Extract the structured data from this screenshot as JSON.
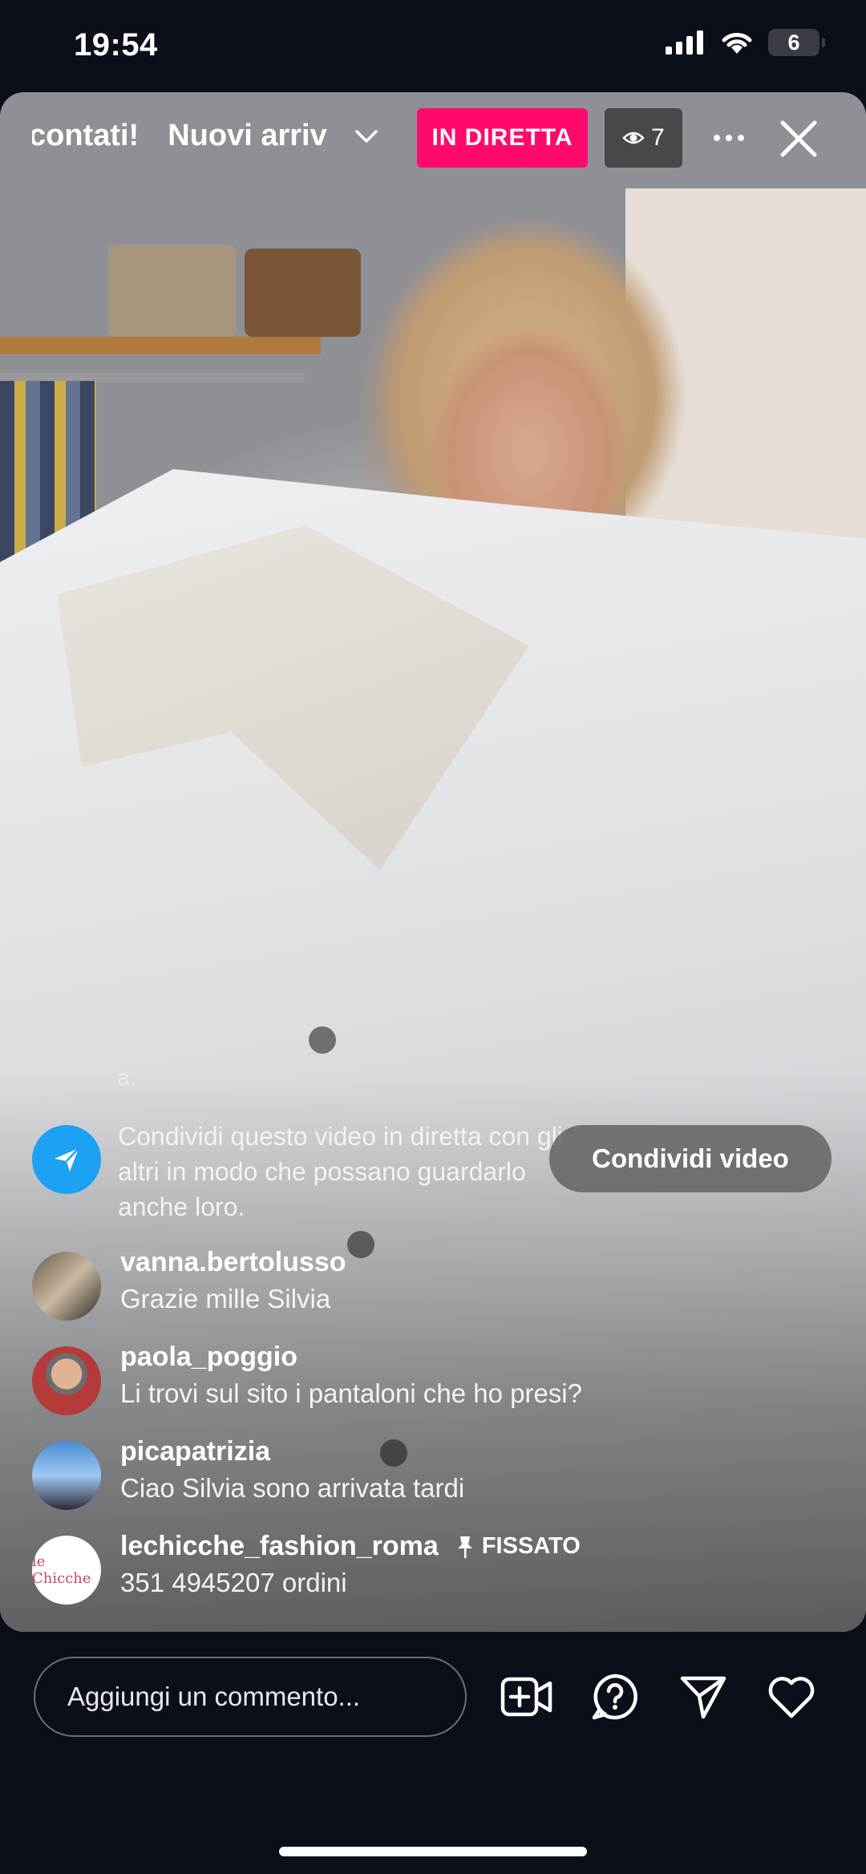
{
  "status_bar": {
    "time": "19:54",
    "battery": "6"
  },
  "live_header": {
    "title_segments": [
      "contati!",
      "Nuovi arriv"
    ],
    "live_badge": "IN DIRETTA",
    "viewer_count": "7"
  },
  "overlay_caption": "a.",
  "share_prompt": {
    "text": "Condividi questo video in diretta con gli altri in modo che possano guardarlo anche loro.",
    "button": "Condividi video"
  },
  "comments": [
    {
      "username": "vanna.bertolusso",
      "text": "Grazie mille Silvia"
    },
    {
      "username": "paola_poggio",
      "text": "Li trovi sul sito i pantaloni che ho presi?"
    },
    {
      "username": "picapatrizia",
      "text": "Ciao Silvia sono arrivata tardi"
    },
    {
      "username": "lechicche_fashion_roma",
      "text": "351 4945207 ordini",
      "pinned_label": "FISSATO",
      "avatar_text": "le Chicche"
    }
  ],
  "comment_bar": {
    "placeholder": "Aggiungi un commento..."
  },
  "icons": [
    "signal-icon",
    "wifi-icon",
    "eye-icon",
    "chevron-down-icon",
    "more-icon",
    "close-icon",
    "send-icon",
    "pin-icon",
    "add-guest-video-icon",
    "question-icon",
    "share-icon",
    "heart-icon"
  ]
}
